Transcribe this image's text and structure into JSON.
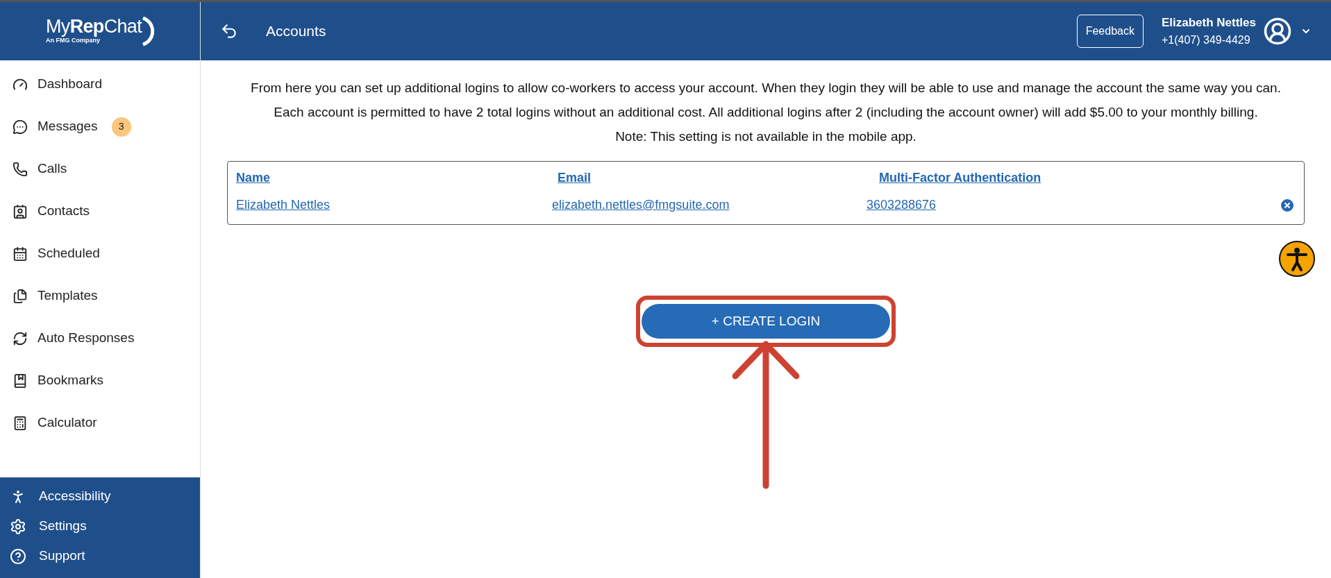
{
  "logo": {
    "name": "My**Rep**Chat",
    "tagline": "An FMG Company"
  },
  "header": {
    "title": "Accounts",
    "feedback": "Feedback",
    "user_name": "Elizabeth Nettles",
    "user_phone": "+1(407) 349-4429"
  },
  "sidebar": {
    "items": [
      {
        "kind": "dashboard",
        "label": "Dashboard"
      },
      {
        "kind": "messages",
        "label": "Messages",
        "badge": "3"
      },
      {
        "kind": "calls",
        "label": "Calls"
      },
      {
        "kind": "contacts",
        "label": "Contacts"
      },
      {
        "kind": "scheduled",
        "label": "Scheduled"
      },
      {
        "kind": "templates",
        "label": "Templates"
      },
      {
        "kind": "auto",
        "label": "Auto Responses"
      },
      {
        "kind": "bookmarks",
        "label": "Bookmarks"
      },
      {
        "kind": "calculator",
        "label": "Calculator"
      }
    ],
    "footer_items": [
      {
        "kind": "accessibility",
        "label": "Accessibility"
      },
      {
        "kind": "settings",
        "label": "Settings"
      },
      {
        "kind": "support",
        "label": "Support"
      }
    ]
  },
  "intro": [
    "From here you can set up additional logins to allow co-workers to access your account. When they login they will be able to use and manage the account the same way you can.",
    "Each account is permitted to have 2 total logins without an additional cost. All additional logins after 2 (including the account owner) will add $5.00 to your monthly billing.",
    "Note: This setting is not available in the mobile app."
  ],
  "table": {
    "columns": [
      "Name",
      "Email",
      "Multi-Factor Authentication"
    ],
    "rows": [
      {
        "cells": [
          "Elizabeth Nettles",
          "elizabeth.nettles@fmgsuite.com",
          "3603288676"
        ]
      }
    ]
  },
  "create_button": "+ CREATE LOGIN"
}
